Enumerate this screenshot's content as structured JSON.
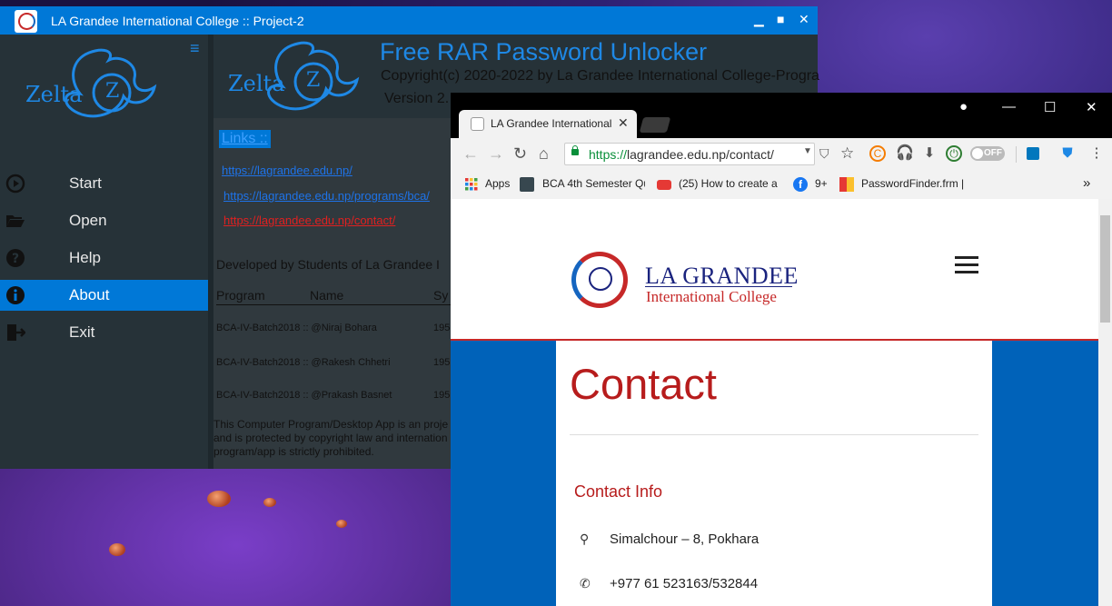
{
  "desktop": {
    "wallpaper": "purple fantasy landscape"
  },
  "app": {
    "title": "LA Grandee International College :: Project-2",
    "window_controls": [
      "▁",
      "■",
      "✕"
    ],
    "logo_text": "Zelta",
    "logo_letter": "Z",
    "product_title": "Free RAR Password Unlocker",
    "copyright": "Copyright(c) 2020-2022 by La Grandee International College-Progra",
    "version": "Version 2.",
    "nav": [
      {
        "label": "Start",
        "icon": "play-circle-icon"
      },
      {
        "label": "Open",
        "icon": "folder-open-icon"
      },
      {
        "label": "Help",
        "icon": "help-circle-icon"
      },
      {
        "label": "About",
        "icon": "info-circle-icon",
        "active": true
      },
      {
        "label": "Exit",
        "icon": "exit-icon"
      }
    ],
    "links_heading": "Links ::",
    "links": [
      {
        "text": "https://lagrandee.edu.np/",
        "color": "#1e73e8"
      },
      {
        "text": "https://lagrandee.edu.np/programs/bca/",
        "color": "#1e73e8"
      },
      {
        "text": "https://lagrandee.edu.np/contact/",
        "color": "#e02020"
      }
    ],
    "developed_by": "Developed by Students of La Grandee I",
    "columns": [
      "Program",
      "Name",
      "Sy"
    ],
    "developers": [
      {
        "row": "BCA-IV-Batch2018 :: @Niraj Bohara",
        "roll": "195"
      },
      {
        "row": "BCA-IV-Batch2018 :: @Rakesh Chhetri",
        "roll": "195"
      },
      {
        "row": "BCA-IV-Batch2018 :: @Prakash Basnet",
        "roll": "195"
      }
    ],
    "notice_lines": [
      "This Computer Program/Desktop App is an proje",
      "and is protected by copyright law and internation",
      "program/app is strictly prohibited."
    ]
  },
  "browser": {
    "tab_title": "LA Grandee International College",
    "url_scheme": "https://",
    "url_rest": "lagrandee.edu.np/contact/",
    "toggle_label": "OFF",
    "bookmarks": [
      {
        "label": "Apps"
      },
      {
        "label": "BCA 4th Semester Qu"
      },
      {
        "label": "(25) How to create a"
      },
      {
        "label": "9+"
      },
      {
        "label": "PasswordFinder.frm |"
      }
    ],
    "overflow": "»"
  },
  "site": {
    "name_line1": "LA GRANDEE",
    "name_line2": "International College",
    "page_title": "Contact",
    "section": "Contact Info",
    "address": "Simalchour – 8, Pokhara",
    "phone": "+977 61 523163/532844",
    "colors": {
      "brand_red": "#b71c1c",
      "brand_blue": "#1a237e",
      "band": "#0062b9"
    }
  }
}
